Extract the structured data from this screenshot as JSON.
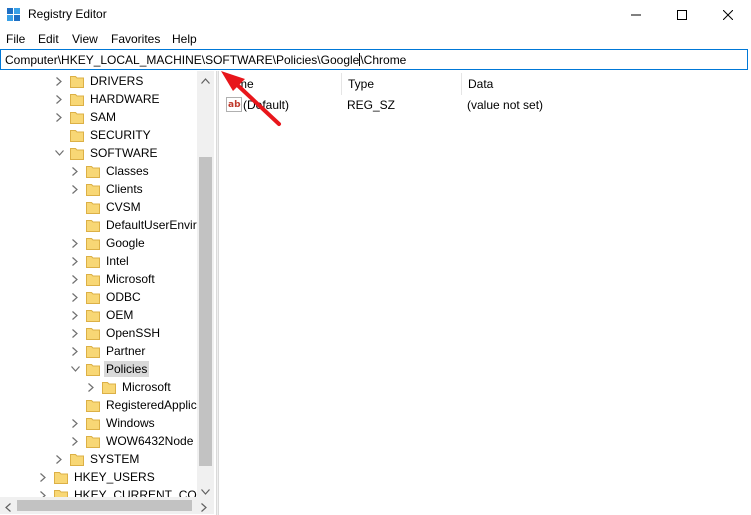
{
  "window": {
    "title": "Registry Editor",
    "controls": [
      "minimize-icon",
      "maximize-icon",
      "close-icon"
    ]
  },
  "menu": [
    "File",
    "Edit",
    "View",
    "Favorites",
    "Help"
  ],
  "address": {
    "path_before_caret": "Computer\\HKEY_LOCAL_MACHINE\\SOFTWARE\\Policies\\Google",
    "path_after_caret": "\\Chrome"
  },
  "tree": {
    "nodes": [
      {
        "label": "DRIVERS",
        "level": 2,
        "expander": "collapsed"
      },
      {
        "label": "HARDWARE",
        "level": 2,
        "expander": "collapsed"
      },
      {
        "label": "SAM",
        "level": 2,
        "expander": "collapsed"
      },
      {
        "label": "SECURITY",
        "level": 2,
        "expander": "none"
      },
      {
        "label": "SOFTWARE",
        "level": 2,
        "expander": "expanded"
      },
      {
        "label": "Classes",
        "level": 3,
        "expander": "collapsed"
      },
      {
        "label": "Clients",
        "level": 3,
        "expander": "collapsed"
      },
      {
        "label": "CVSM",
        "level": 3,
        "expander": "none"
      },
      {
        "label": "DefaultUserEnvironn",
        "level": 3,
        "expander": "none"
      },
      {
        "label": "Google",
        "level": 3,
        "expander": "collapsed"
      },
      {
        "label": "Intel",
        "level": 3,
        "expander": "collapsed"
      },
      {
        "label": "Microsoft",
        "level": 3,
        "expander": "collapsed"
      },
      {
        "label": "ODBC",
        "level": 3,
        "expander": "collapsed"
      },
      {
        "label": "OEM",
        "level": 3,
        "expander": "collapsed"
      },
      {
        "label": "OpenSSH",
        "level": 3,
        "expander": "collapsed"
      },
      {
        "label": "Partner",
        "level": 3,
        "expander": "collapsed"
      },
      {
        "label": "Policies",
        "level": 3,
        "expander": "expanded",
        "selected": true
      },
      {
        "label": "Microsoft",
        "level": 4,
        "expander": "collapsed"
      },
      {
        "label": "RegisteredApplicatio",
        "level": 3,
        "expander": "none"
      },
      {
        "label": "Windows",
        "level": 3,
        "expander": "collapsed"
      },
      {
        "label": "WOW6432Node",
        "level": 3,
        "expander": "collapsed"
      },
      {
        "label": "SYSTEM",
        "level": 2,
        "expander": "collapsed"
      },
      {
        "label": "HKEY_USERS",
        "level": 1,
        "expander": "collapsed"
      },
      {
        "label": "HKEY_CURRENT_CONFIG",
        "level": 1,
        "expander": "collapsed"
      }
    ]
  },
  "list": {
    "columns": [
      "me",
      "Type",
      "Data"
    ],
    "rows": [
      {
        "name": "(Default)",
        "type": "REG_SZ",
        "data": "(value not set)",
        "icon": "string-value-icon"
      }
    ]
  },
  "colors": {
    "accent": "#0078d7",
    "folder": "#f8d775",
    "folder_edge": "#dcb046",
    "arrow": "#e8161b",
    "selection": "#d9d9d9"
  }
}
